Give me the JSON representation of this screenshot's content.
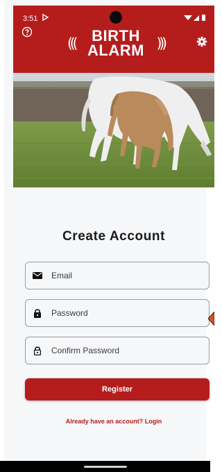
{
  "status_bar": {
    "time": "3:51"
  },
  "header": {
    "logo_line1": "BIRTH",
    "logo_line2": "ALARM",
    "logo_waves_left": "(((",
    "logo_waves_right": ")))",
    "help_icon": "help-circle-icon",
    "settings_icon": "gear-icon"
  },
  "hero": {
    "image": "horses-grazing-photo"
  },
  "form": {
    "title": "Create Account",
    "email_placeholder": "Email",
    "email_icon": "envelope-icon",
    "password_placeholder": "Password",
    "password_icon": "lock-filled-icon",
    "confirm_placeholder": "Confirm Password",
    "confirm_icon": "lock-outline-icon",
    "register_label": "Register",
    "login_link": "Already have an account? Login"
  },
  "colors": {
    "brand_red": "#b51d1d",
    "background": "#f6f7f9",
    "field_border": "#9a9a9a"
  }
}
